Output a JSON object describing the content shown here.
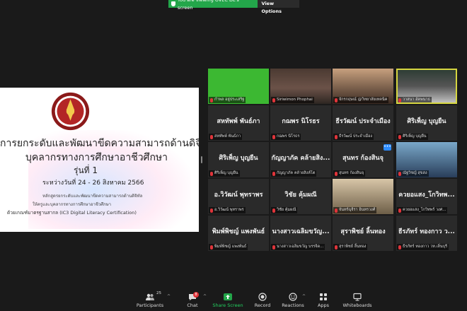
{
  "banner": {
    "viewing_text": "You are viewing OVEC DL's screen",
    "options_label": "View Options"
  },
  "slide": {
    "line1": "การยกระดับและพัฒนาขีดความสามารถด้านดิจิทัลให้ครูและ",
    "line2": "บุคลากรทางการศึกษาอาชีวศึกษา",
    "line3": "รุ่นที่ 1",
    "line4": "ระหว่างวันที่ 24 - 26 สิงหาคม 2566",
    "sub1": "หลักสูตรยกระดับและพัฒนาขีดความสามารถด้านดิจิทัล",
    "sub2": "ให้ครูและบุคลากรทางการศึกษาอาชีวศึกษา",
    "sub3": "ด้วยเกณฑ์มาตรฐานสากล (IC3 Digital Literacy Certification)"
  },
  "participants": [
    {
      "display": "",
      "label": "กำพล อยู่ประเสริฐ",
      "video": "green"
    },
    {
      "display": "",
      "label": "Siriwimon Phophai",
      "video": "face1"
    },
    {
      "display": "",
      "label": "จักรกฤษณ์ @วิทยาลัยเทคนิค",
      "video": "face2"
    },
    {
      "display": "",
      "label": "วาสนา อัคพนาธ",
      "video": "face3"
    },
    {
      "display": "สหทัพพ์ พันธ์ภา",
      "label": "สหทัพพ์ พันธ์ภา"
    },
    {
      "display": "กฌพร นิโรธร",
      "label": "กฌพร นิโรธร"
    },
    {
      "display": "ธีรวัฒน์ ประจำเมือง",
      "label": "ธีรวัฒน์ ประจำเมือง"
    },
    {
      "display": "ศิริเพ็ญ บุญยืน",
      "label": "ศิริเพ็ญ บุญยืน"
    },
    {
      "display": "ศิริเพ็ญ บุญยืน",
      "label": "ศิริเพ็ญ บุญยืน"
    },
    {
      "display": "กัญญาภัค คล้ายสิง...",
      "label": "กัญญาภัค คล้ายสิงห์โต"
    },
    {
      "display": "สุนทร ก้องสินจุ",
      "label": "สุนทร ก้องสินจุ"
    },
    {
      "display": "",
      "label": "ณัฐวิชญ์ สุขสง",
      "video": "face4"
    },
    {
      "display": "อ.วิวัฒน์ พุทราพร",
      "label": "อ.วิวัฒน์ พุทราพร"
    },
    {
      "display": "วิชัย คุ้มผณี",
      "label": "วิชัย คุ้มผณี"
    },
    {
      "display": "",
      "label": "จันทร์ฉุจีรา อินทรวงศ์",
      "video": "cat"
    },
    {
      "display": "ควยอแสง_โกวิทพ...",
      "label": "ควยอแสง_โกวิทพร์ วงศ..."
    },
    {
      "display": "พิมพ์พิชญ์ แพงพันธ์",
      "label": "พิมพ์พิชญ์ แพงพันธ์"
    },
    {
      "display": "นางสาวเฉลิมขวัญ...",
      "label": "นางสาวเฉลิมขวัญ บรรจิด..."
    },
    {
      "display": "สุราพิชย์ ลิ้นทอง",
      "label": "สุราพิชย์ ลิ้นทอง"
    },
    {
      "display": "ธีรภัทร์ ทองกาว ว...",
      "label": "ธีรภัทร์ ทองกาว วท.เลิ่นบุรี"
    }
  ],
  "toolbar": {
    "participants_label": "Participants",
    "participants_count": "25",
    "chat_label": "Chat",
    "chat_badge": "8",
    "share_label": "Share Screen",
    "record_label": "Record",
    "reactions_label": "Reactions",
    "apps_label": "Apps",
    "whiteboards_label": "Whiteboards"
  }
}
